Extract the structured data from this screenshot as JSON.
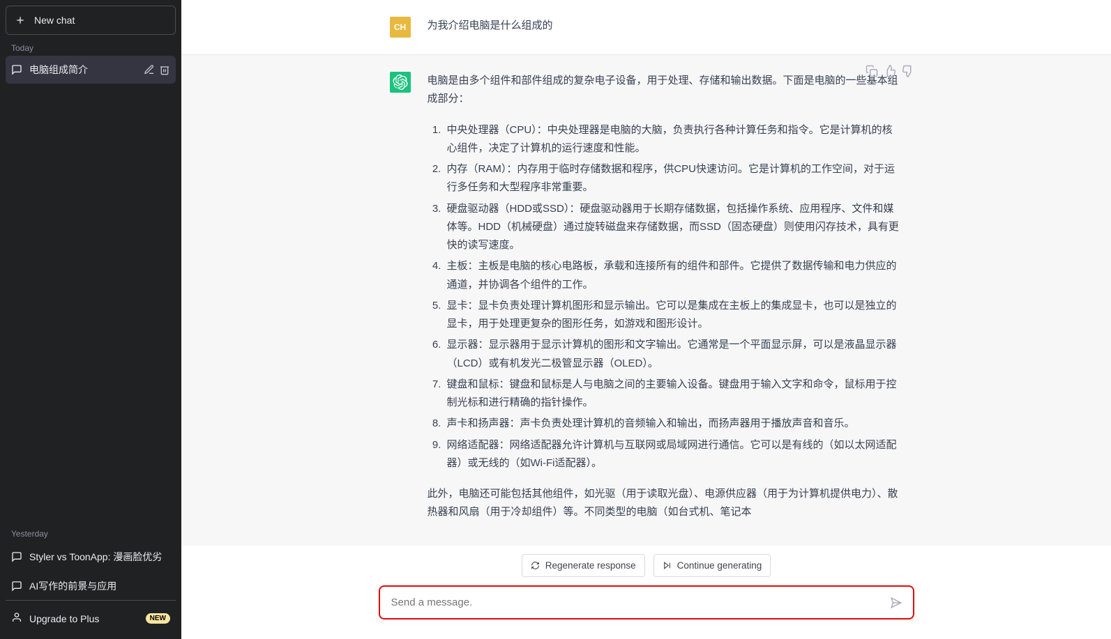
{
  "sidebar": {
    "new_chat_label": "New chat",
    "today_label": "Today",
    "yesterday_label": "Yesterday",
    "today_items": [
      {
        "label": "电脑组成简介"
      }
    ],
    "yesterday_items": [
      {
        "label": "Styler vs ToonApp: 漫画脸优劣"
      },
      {
        "label": "AI写作的前景与应用"
      }
    ],
    "upgrade_label": "Upgrade to Plus",
    "upgrade_badge": "NEW"
  },
  "conversation": {
    "user_avatar": "CH",
    "user_message": "为我介绍电脑是什么组成的",
    "assistant_intro": "电脑是由多个组件和部件组成的复杂电子设备，用于处理、存储和输出数据。下面是电脑的一些基本组成部分：",
    "assistant_list": [
      "中央处理器（CPU）：中央处理器是电脑的大脑，负责执行各种计算任务和指令。它是计算机的核心组件，决定了计算机的运行速度和性能。",
      "内存（RAM）：内存用于临时存储数据和程序，供CPU快速访问。它是计算机的工作空间，对于运行多任务和大型程序非常重要。",
      "硬盘驱动器（HDD或SSD）：硬盘驱动器用于长期存储数据，包括操作系统、应用程序、文件和媒体等。HDD（机械硬盘）通过旋转磁盘来存储数据，而SSD（固态硬盘）则使用闪存技术，具有更快的读写速度。",
      "主板：主板是电脑的核心电路板，承载和连接所有的组件和部件。它提供了数据传输和电力供应的通道，并协调各个组件的工作。",
      "显卡：显卡负责处理计算机图形和显示输出。它可以是集成在主板上的集成显卡，也可以是独立的显卡，用于处理更复杂的图形任务，如游戏和图形设计。",
      "显示器：显示器用于显示计算机的图形和文字输出。它通常是一个平面显示屏，可以是液晶显示器（LCD）或有机发光二极管显示器（OLED）。",
      "键盘和鼠标：键盘和鼠标是人与电脑之间的主要输入设备。键盘用于输入文字和命令，鼠标用于控制光标和进行精确的指针操作。",
      "声卡和扬声器：声卡负责处理计算机的音频输入和输出，而扬声器用于播放声音和音乐。",
      "网络适配器：网络适配器允许计算机与互联网或局域网进行通信。它可以是有线的（如以太网适配器）或无线的（如Wi-Fi适配器）。"
    ],
    "assistant_outro": "此外，电脑还可能包括其他组件，如光驱（用于读取光盘）、电源供应器（用于为计算机提供电力）、散热器和风扇（用于冷却组件）等。不同类型的电脑（如台式机、笔记本"
  },
  "footer": {
    "regenerate_label": "Regenerate response",
    "continue_label": "Continue generating",
    "input_placeholder": "Send a message."
  }
}
